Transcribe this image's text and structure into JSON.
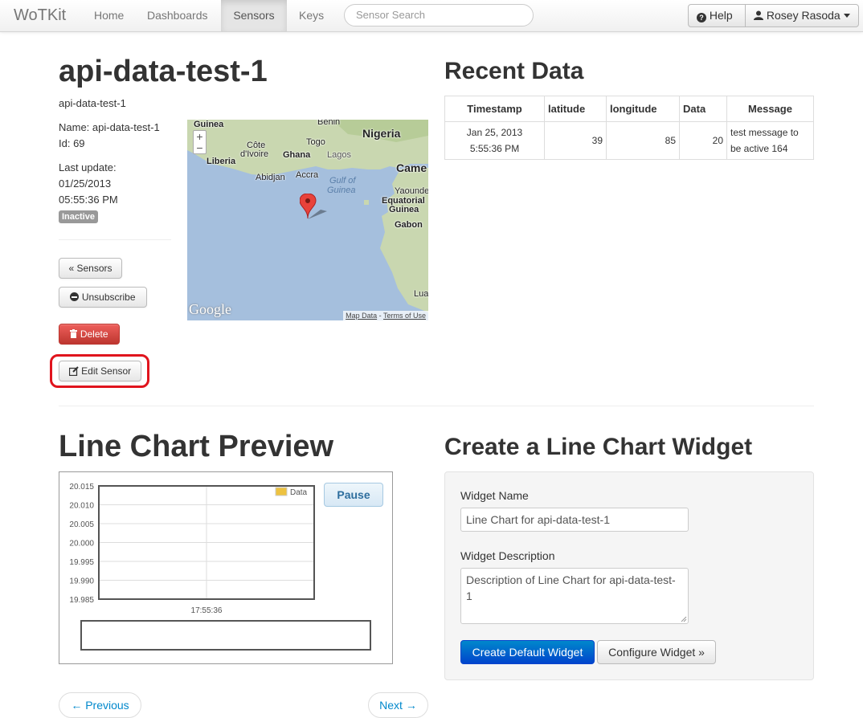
{
  "navbar": {
    "brand": "WoTKit",
    "items": [
      {
        "label": "Home",
        "active": false
      },
      {
        "label": "Dashboards",
        "active": false
      },
      {
        "label": "Sensors",
        "active": true
      },
      {
        "label": "Keys",
        "active": false
      }
    ],
    "search_placeholder": "Sensor Search",
    "help_label": "Help",
    "user_label": "Rosey Rasoda"
  },
  "sensor": {
    "title": "api-data-test-1",
    "description": "api-data-test-1",
    "name_line": "Name: api-data-test-1",
    "id_line": "Id: 69",
    "last_update_label": "Last update:",
    "last_update_date": "01/25/2013",
    "last_update_time": "05:55:36 PM",
    "status": "Inactive"
  },
  "actions": {
    "sensors_label": "« Sensors",
    "unsubscribe_label": "Unsubscribe",
    "delete_label": "Delete",
    "edit_label": "Edit Sensor"
  },
  "map": {
    "labels": {
      "guinea": "Guinea",
      "benin": "Benin",
      "nigeria": "Nigeria",
      "cote": "Côte",
      "divoire": "d'Ivoire",
      "togo": "Togo",
      "ghana": "Ghana",
      "lagos": "Lagos",
      "liberia": "Liberia",
      "abidjan": "Abidjan",
      "accra": "Accra",
      "gulf1": "Gulf of",
      "gulf2": "Guinea",
      "came": "Came",
      "yaounde": "Yaounde",
      "eqguinea1": "Equatorial",
      "eqguinea2": "Guinea",
      "gabon": "Gabon",
      "lua": "Lua"
    },
    "logo": "Google",
    "map_data_link": "Map Data",
    "terms_link": "Terms of Use"
  },
  "recent_data": {
    "title": "Recent Data",
    "columns": [
      "Timestamp",
      "latitude",
      "longitude",
      "Data",
      "Message"
    ],
    "rows": [
      {
        "timestamp_date": "Jan 25, 2013",
        "timestamp_time": "5:55:36 PM",
        "latitude": "39",
        "longitude": "85",
        "data": "20",
        "message_1": "test message to",
        "message_2": "be active 164"
      }
    ]
  },
  "line_chart_preview": {
    "title": "Line Chart Preview",
    "pause_label": "Pause"
  },
  "chart_data": {
    "type": "line",
    "series": [
      {
        "name": "Data",
        "values": []
      }
    ],
    "y_ticks": [
      "20.015",
      "20.010",
      "20.005",
      "20.000",
      "19.995",
      "19.990",
      "19.985"
    ],
    "x_ticks": [
      "17:55:36"
    ],
    "ylim": [
      19.985,
      20.015
    ],
    "legend": "top-right",
    "grid": true
  },
  "widget_form": {
    "title": "Create a Line Chart Widget",
    "name_label": "Widget Name",
    "name_value": "Line Chart for api-data-test-1",
    "description_label": "Widget Description",
    "description_line1": "Description of Line Chart for api-data-test-",
    "description_line2": "1",
    "create_label": "Create Default Widget",
    "configure_label": "Configure Widget »"
  },
  "pager": {
    "previous_label": "← Previous",
    "next_label": "Next →"
  }
}
